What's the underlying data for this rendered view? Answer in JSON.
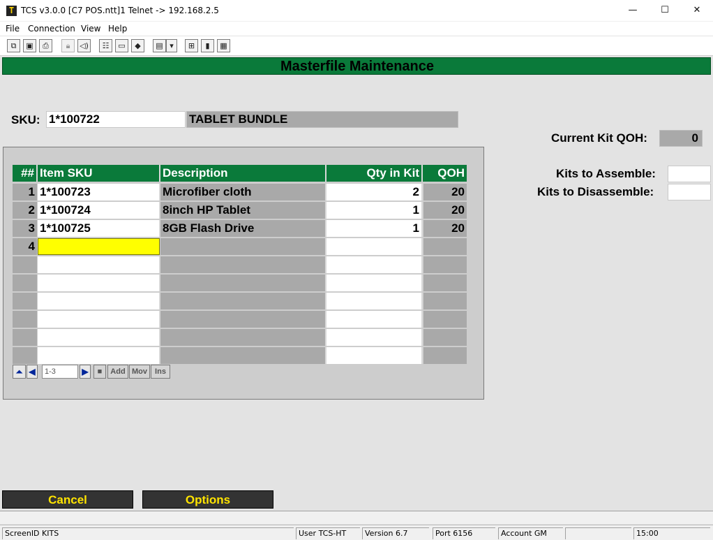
{
  "window": {
    "title": "TCS v3.0.0 [C7 POS.ntt]1 Telnet -> 192.168.2.5",
    "app_icon": "T",
    "controls": {
      "minimize": "—",
      "maximize": "☐",
      "close": "✕"
    }
  },
  "menu": [
    {
      "label": "File"
    },
    {
      "label": "Connection"
    },
    {
      "label": "View"
    },
    {
      "label": "Help"
    }
  ],
  "toolbar": {
    "icons": [
      "copy-icon",
      "save-icon",
      "print-icon",
      "lock-icon",
      "sound-icon",
      "properties-icon",
      "monitor-icon",
      "book-icon",
      "screens-dropdown-icon",
      "dropdown-arrow-icon",
      "network-icon",
      "chart-icon",
      "calculator-icon"
    ]
  },
  "screen": {
    "title": "Masterfile Maintenance",
    "sku_label": "SKU:",
    "sku_value": "1*100722",
    "sku_description": "TABLET BUNDLE",
    "current_kit_qoh_label": "Current Kit QOH:",
    "current_kit_qoh_value": "0",
    "kits_to_assemble_label": "Kits to Assemble:",
    "kits_to_assemble_value": "",
    "kits_to_disassemble_label": "Kits to Disassemble:",
    "kits_to_disassemble_value": ""
  },
  "grid": {
    "headers": {
      "num": "##",
      "item_sku": "Item SKU",
      "description": "Description",
      "qty_in_kit": "Qty in Kit",
      "qoh": "QOH"
    },
    "rows": [
      {
        "num": "1",
        "item_sku": "1*100723",
        "description": "Microfiber cloth",
        "qty_in_kit": "2",
        "qoh": "20"
      },
      {
        "num": "2",
        "item_sku": "1*100724",
        "description": "8inch HP Tablet",
        "qty_in_kit": "1",
        "qoh": "20"
      },
      {
        "num": "3",
        "item_sku": "1*100725",
        "description": "8GB Flash Drive",
        "qty_in_kit": "1",
        "qoh": "20"
      },
      {
        "num": "4",
        "item_sku": "",
        "description": "",
        "qty_in_kit": "",
        "qoh": ""
      },
      {
        "num": "",
        "item_sku": "",
        "description": "",
        "qty_in_kit": "",
        "qoh": ""
      },
      {
        "num": "",
        "item_sku": "",
        "description": "",
        "qty_in_kit": "",
        "qoh": ""
      },
      {
        "num": "",
        "item_sku": "",
        "description": "",
        "qty_in_kit": "",
        "qoh": ""
      },
      {
        "num": "",
        "item_sku": "",
        "description": "",
        "qty_in_kit": "",
        "qoh": ""
      },
      {
        "num": "",
        "item_sku": "",
        "description": "",
        "qty_in_kit": "",
        "qoh": ""
      },
      {
        "num": "",
        "item_sku": "",
        "description": "",
        "qty_in_kit": "",
        "qoh": ""
      }
    ],
    "navigator": {
      "range": "1-3",
      "add": "Add",
      "mov": "Mov",
      "ins": "Ins"
    }
  },
  "buttons": {
    "cancel": "Cancel",
    "options": "Options"
  },
  "status": {
    "screen_id": "ScreenID KITS",
    "user": "User TCS-HT",
    "version": "Version 6.7",
    "port": "Port 6156",
    "account": "Account GM",
    "time": "15:00"
  }
}
